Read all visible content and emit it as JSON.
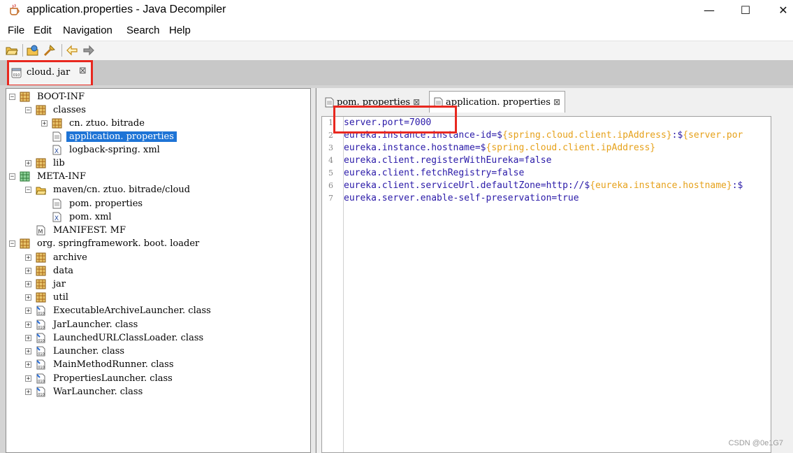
{
  "window": {
    "title": "application.properties - Java Decompiler",
    "minimize": "—",
    "maximize": "☐",
    "close": "✕"
  },
  "menu": [
    "File",
    "Edit",
    "Navigation",
    "Search",
    "Help"
  ],
  "jar_tab": {
    "label": "cloud. jar",
    "close": "⊠"
  },
  "tree": [
    {
      "label": "BOOT-INF",
      "icon": "package-icon",
      "expander": "−"
    },
    {
      "label": "classes",
      "icon": "package-icon",
      "expander": "−"
    },
    {
      "label": "cn. ztuo. bitrade",
      "icon": "package-icon",
      "expander": "+"
    },
    {
      "label": "application. properties",
      "icon": "text-file-icon",
      "expander": ""
    },
    {
      "label": "logback-spring. xml",
      "icon": "xml-file-icon",
      "expander": ""
    },
    {
      "label": "lib",
      "icon": "package-icon",
      "expander": "+"
    },
    {
      "label": "META-INF",
      "icon": "package-green-icon",
      "expander": "−"
    },
    {
      "label": "maven/cn. ztuo. bitrade/cloud",
      "icon": "folder-icon",
      "expander": "−"
    },
    {
      "label": "pom. properties",
      "icon": "text-file-icon",
      "expander": ""
    },
    {
      "label": "pom. xml",
      "icon": "xml-file-icon",
      "expander": ""
    },
    {
      "label": "MANIFEST. MF",
      "icon": "manifest-icon",
      "expander": ""
    },
    {
      "label": "org. springframework. boot. loader",
      "icon": "package-icon",
      "expander": "−"
    },
    {
      "label": "archive",
      "icon": "package-icon",
      "expander": "+"
    },
    {
      "label": "data",
      "icon": "package-icon",
      "expander": "+"
    },
    {
      "label": "jar",
      "icon": "package-icon",
      "expander": "+"
    },
    {
      "label": "util",
      "icon": "package-icon",
      "expander": "+"
    },
    {
      "label": "ExecutableArchiveLauncher. class",
      "icon": "class-file-icon",
      "expander": "+"
    },
    {
      "label": "JarLauncher. class",
      "icon": "class-file-icon",
      "expander": "+"
    },
    {
      "label": "LaunchedURLClassLoader. class",
      "icon": "class-file-icon",
      "expander": "+"
    },
    {
      "label": "Launcher. class",
      "icon": "class-file-icon",
      "expander": "+"
    },
    {
      "label": "MainMethodRunner. class",
      "icon": "class-file-icon",
      "expander": "+"
    },
    {
      "label": "PropertiesLauncher. class",
      "icon": "class-file-icon",
      "expander": "+"
    },
    {
      "label": "WarLauncher. class",
      "icon": "class-file-icon",
      "expander": "+"
    }
  ],
  "selected_item": "application. properties",
  "editor_tabs": [
    {
      "label": "pom. properties",
      "close": "⊠"
    },
    {
      "label": "application. properties",
      "close": "⊠"
    }
  ],
  "code": {
    "line_numbers": [
      "1",
      "2",
      "3",
      "4",
      "5",
      "6",
      "7"
    ],
    "lines": [
      [
        {
          "t": "server.port=",
          "c": "k"
        },
        {
          "t": "7000",
          "c": "v"
        }
      ],
      [
        {
          "t": "eureka.instance.instance-id=$",
          "c": "k"
        },
        {
          "t": "{spring.cloud.client.ipAddress}",
          "c": "p"
        },
        {
          "t": ":$",
          "c": "k"
        },
        {
          "t": "{server.por",
          "c": "p"
        }
      ],
      [
        {
          "t": "eureka.instance.hostname=$",
          "c": "k"
        },
        {
          "t": "{spring.cloud.client.ipAddress}",
          "c": "p"
        }
      ],
      [
        {
          "t": "eureka.client.registerWithEureka=",
          "c": "k"
        },
        {
          "t": "false",
          "c": "v"
        }
      ],
      [
        {
          "t": "eureka.client.fetchRegistry=",
          "c": "k"
        },
        {
          "t": "false",
          "c": "v"
        }
      ],
      [
        {
          "t": "eureka.client.serviceUrl.defaultZone=http://$",
          "c": "k"
        },
        {
          "t": "{eureka.instance.hostname}",
          "c": "p"
        },
        {
          "t": ":$",
          "c": "k"
        }
      ],
      [
        {
          "t": "eureka.server.enable-self-preservation=",
          "c": "k"
        },
        {
          "t": "true",
          "c": "v"
        }
      ]
    ]
  },
  "watermark": "CSDN @0e1G7",
  "colors": {
    "highlight": "#e8281f",
    "selection": "#1e74d6",
    "keyword": "#2a1aa8",
    "placeholder": "#e6a11a"
  }
}
